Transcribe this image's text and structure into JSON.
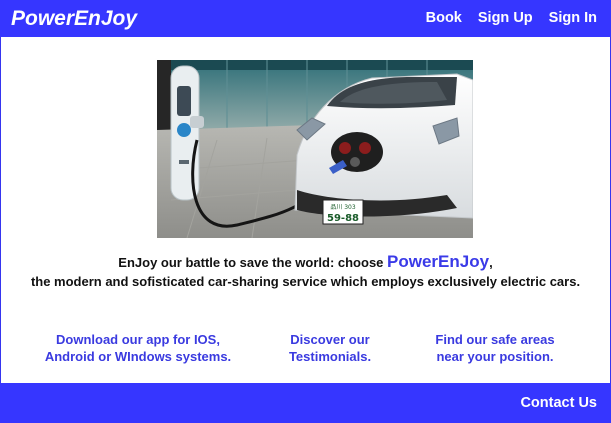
{
  "header": {
    "brand": "PowerEnJoy",
    "nav": [
      "Book",
      "Sign Up",
      "Sign In"
    ]
  },
  "hero": {
    "image": "electric-car-charging-photo",
    "plate_line1": "品川 303",
    "plate_line2": "59-88"
  },
  "tagline": {
    "line1_prefix": "EnJoy our battle to save the world: choose ",
    "line1_brand": "PowerEnJoy",
    "line1_suffix": ",",
    "line2": "the modern and sofisticated car-sharing service which employs exclusively electric cars."
  },
  "links": {
    "app_line1": "Download our app for IOS,",
    "app_line2": "Android or WIndows systems.",
    "testimonials_line1": "Discover our",
    "testimonials_line2": "Testimonials.",
    "areas_line1": "Find our safe areas",
    "areas_line2": "near your position."
  },
  "footer": {
    "contact": "Contact Us"
  },
  "colors": {
    "primary": "#3636ff",
    "link": "#3a3ae0"
  }
}
